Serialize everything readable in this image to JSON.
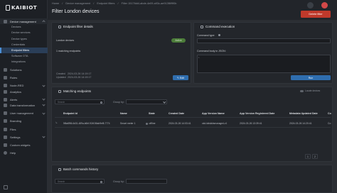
{
  "app": {
    "logo_text": "KAIBIOT"
  },
  "sidebar": {
    "items": [
      {
        "label": "Device management",
        "expanded": true
      },
      {
        "label": "Devices"
      },
      {
        "label": "Device services"
      },
      {
        "label": "Device types"
      },
      {
        "label": "Credentials"
      },
      {
        "label": "Endpoint filters",
        "active": true
      },
      {
        "label": "Software OTA"
      },
      {
        "label": "Integrations"
      },
      {
        "label": "Solutions"
      },
      {
        "label": "Rules"
      },
      {
        "label": "Node-RED"
      },
      {
        "label": "Analytics"
      },
      {
        "label": "Alerts"
      },
      {
        "label": "Data transformation"
      },
      {
        "label": "User management"
      },
      {
        "label": "Branding"
      },
      {
        "label": "Files"
      },
      {
        "label": "Settings"
      },
      {
        "label": "Custom widgets"
      },
      {
        "label": "Help"
      }
    ]
  },
  "breadcrumb": [
    "Home",
    "/",
    "Device management",
    "/",
    "Endpoint filters",
    "/",
    "Filter 1517fdd4-abde-4e09-a93c-ae913f6f9f0b"
  ],
  "page": {
    "title": "Filter London devices"
  },
  "header": {
    "delete_label": "Delete filter"
  },
  "endpoint_filter": {
    "title": "Endpoint filter details",
    "name": "London devices",
    "status": "Active",
    "summary": "1 matching endpoints",
    "created_label": "Created",
    "created_value": "2024-03-26 14:19:17",
    "updated_label": "Updated",
    "updated_value": "2024-03-26 14:19:17",
    "edit_label": "Edit"
  },
  "command": {
    "title": "Command execution",
    "type_label": "Command type:",
    "body_label": "Command body in JSON:",
    "run_label": "Run"
  },
  "matching": {
    "title": "Matching endpoints",
    "search_placeholder": "Search",
    "group_label": "Group by:",
    "toggle_label": "Locate devices",
    "columns": [
      "Endpoint Id",
      "Name",
      "State",
      "Created Date",
      "App Version Name",
      "App Version Registered Date",
      "Metadata Updated Date",
      "Co"
    ],
    "rows": [
      {
        "id": "5f6a8f56-6d31-489a-b6bf-924f1f6ab9ef8-7774",
        "name": "Smart meter 1",
        "state": "offline",
        "created": "2024-03-26 14:03:41",
        "app_version": "okd-kidskidsmanaged-v1",
        "registered": "2024-03-26 13:39:41",
        "meta_updated": "2024-03-26 14:20:41",
        "co": "Co"
      }
    ],
    "pager": [
      "1",
      "2"
    ]
  },
  "batch": {
    "title": "Batch commands history",
    "search_placeholder": "Search",
    "group_label": "Group by:"
  },
  "colors": {
    "accent": "#2f6eaf",
    "danger": "#c0392b",
    "active_nav": "#2a3e58"
  }
}
